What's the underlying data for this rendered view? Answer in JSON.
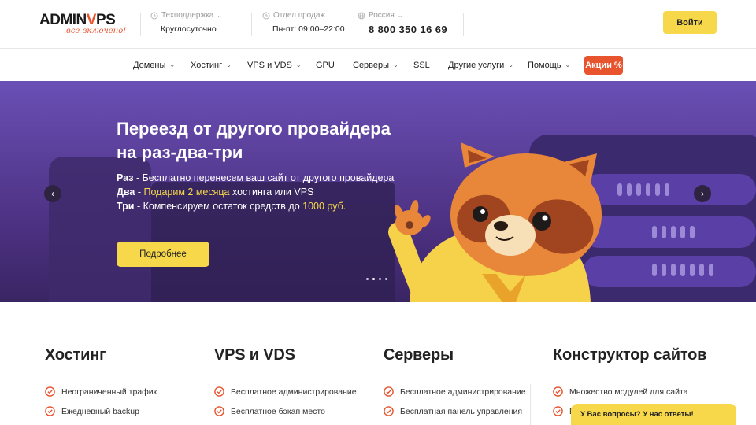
{
  "brand": {
    "logo_prefix": "ADMIN",
    "logo_accent": "V",
    "logo_suffix": "PS",
    "slogan": "все включено!",
    "accent_color": "#e8542e",
    "button_color": "#f7d84b"
  },
  "header": {
    "support": {
      "caption": "Техподдержка",
      "value": "Круглосуточно",
      "icon": "clock-icon"
    },
    "sales": {
      "caption": "Отдел продаж",
      "value": "Пн-пт: 09:00–22:00",
      "icon": "clock-icon"
    },
    "region": {
      "caption": "Россия",
      "phone": "8 800 350 16 69",
      "icon": "globe-icon"
    },
    "login_label": "Войти"
  },
  "nav": {
    "items": [
      {
        "label": "Домены",
        "dropdown": true
      },
      {
        "label": "Хостинг",
        "dropdown": true
      },
      {
        "label": "VPS и VDS",
        "dropdown": true
      },
      {
        "label": "GPU",
        "dropdown": false
      },
      {
        "label": "Серверы",
        "dropdown": true
      },
      {
        "label": "SSL",
        "dropdown": false
      },
      {
        "label": "Другие услуги",
        "dropdown": true
      },
      {
        "label": "Помощь",
        "dropdown": true
      }
    ],
    "promo_label": "Акции %"
  },
  "hero": {
    "title_line1": "Переезд от другого провайдера",
    "title_line2": "на раз-два-три",
    "line1": {
      "key": "Раз",
      "text": " - Бесплатно перенесем ваш сайт от другого провайдера"
    },
    "line2": {
      "key": "Два",
      "pre": " - ",
      "highlight": "Подарим 2 месяца",
      "post": " хостинга или VPS"
    },
    "line3": {
      "key": "Три",
      "pre": " - Компенсируем остаток средств до ",
      "highlight": "1000 руб."
    },
    "button_label": "Подробнее",
    "slide_count": 4,
    "active_slide": 2
  },
  "columns": [
    {
      "title": "Хостинг",
      "features": [
        "Неограниченный трафик",
        "Ежедневный backup"
      ]
    },
    {
      "title": "VPS и VDS",
      "features": [
        "Бесплатное администрирование",
        "Бесплатное бэкап место"
      ]
    },
    {
      "title": "Серверы",
      "features": [
        "Бесплатное администрирование",
        "Бесплатная панель управления"
      ]
    },
    {
      "title": "Конструктор сайтов",
      "features": [
        "Множество модулей для сайта",
        "Еж"
      ]
    }
  ],
  "chat": {
    "label": "У Вас вопросы? У нас ответы!"
  }
}
